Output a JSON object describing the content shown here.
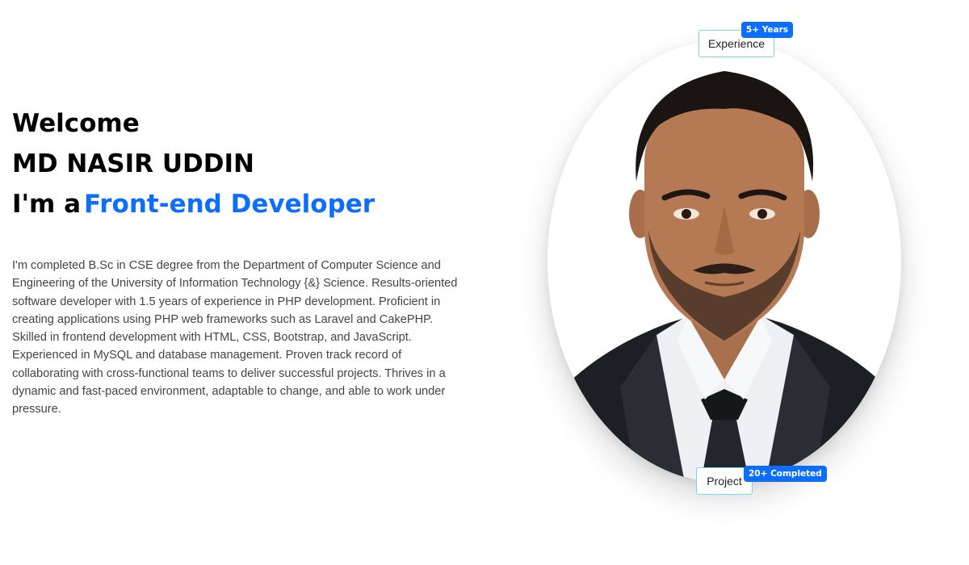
{
  "hero": {
    "welcome": "Welcome",
    "name": "MD NASIR UDDIN",
    "role_prefix": "I'm a",
    "role": "Front-end Developer",
    "bio": "I'm completed B.Sc in CSE degree from the Department of Computer Science and Engineering of the University of Information Technology {&} Science. Results-oriented software developer with 1.5 years of experience in PHP development. Proficient in creating applications using PHP web frameworks such as Laravel and CakePHP. Skilled in frontend development with HTML, CSS, Bootstrap, and JavaScript. Experienced in MySQL and database management. Proven track record of collaborating with cross-functional teams to deliver successful projects. Thrives in a dynamic and fast-paced environment, adaptable to change, and able to work under pressure."
  },
  "stats": {
    "experience_label": "Experience",
    "experience_badge": "5+ Years",
    "project_label": "Project",
    "project_badge": "20+ Completed"
  },
  "colors": {
    "accent": "#0d6efd",
    "card_border": "#7fd3ea"
  }
}
